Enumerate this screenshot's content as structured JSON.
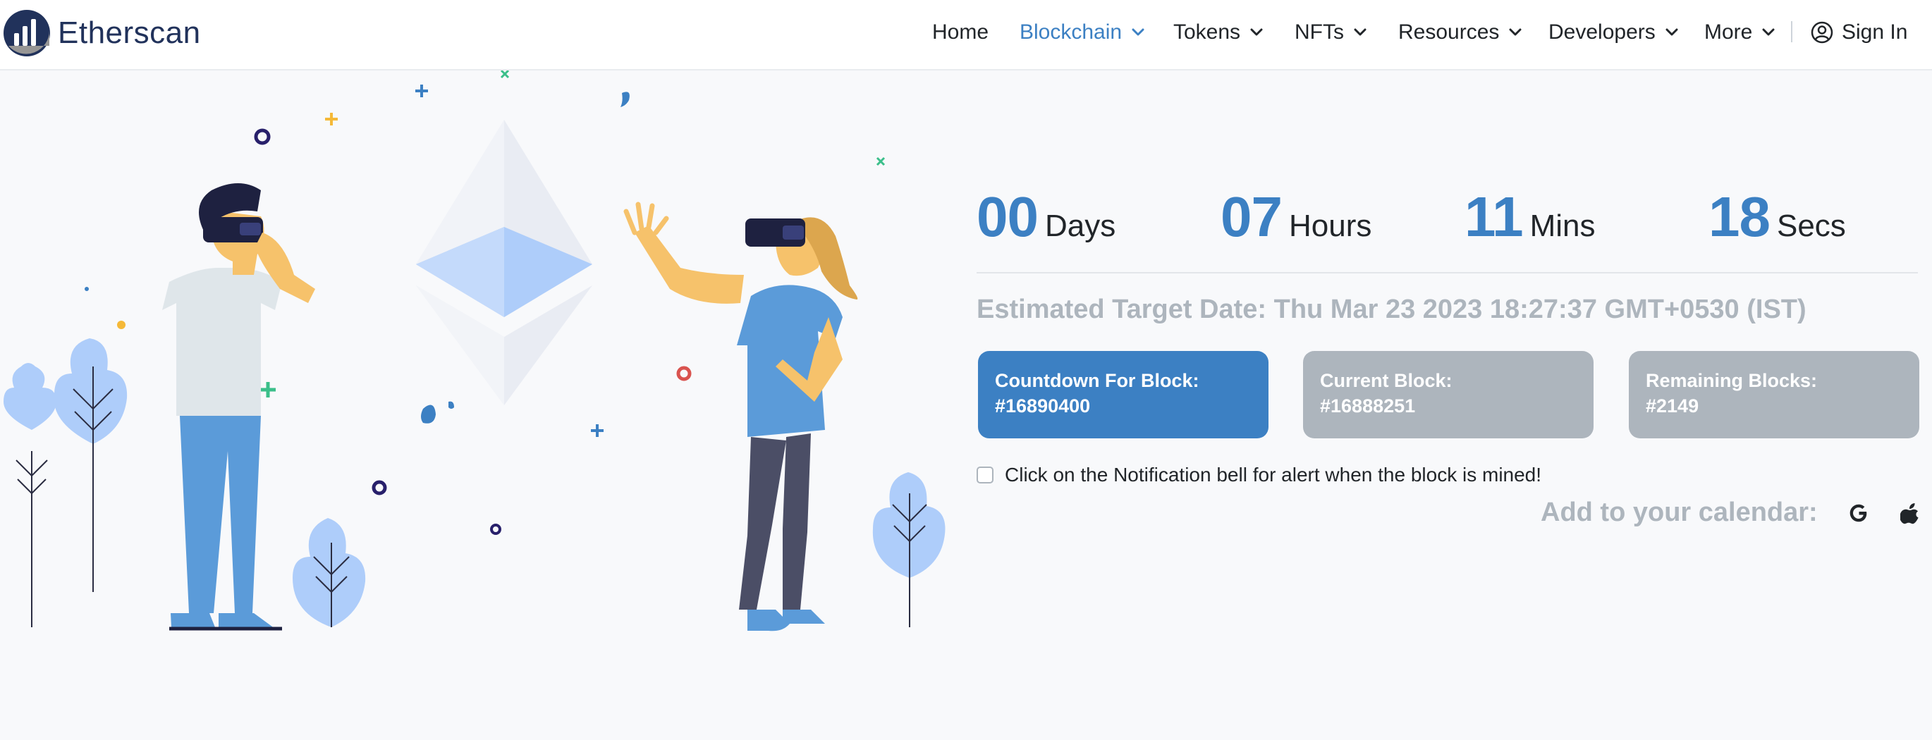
{
  "brand": {
    "name": "Etherscan"
  },
  "nav": {
    "items": [
      {
        "label": "Home",
        "dropdown": false,
        "active": false
      },
      {
        "label": "Blockchain",
        "dropdown": true,
        "active": true
      },
      {
        "label": "Tokens",
        "dropdown": true,
        "active": false
      },
      {
        "label": "NFTs",
        "dropdown": true,
        "active": false
      },
      {
        "label": "Resources",
        "dropdown": true,
        "active": false
      },
      {
        "label": "Developers",
        "dropdown": true,
        "active": false
      },
      {
        "label": "More",
        "dropdown": true,
        "active": false
      }
    ],
    "signin_label": "Sign In",
    "signin_icon": "user-circle-icon"
  },
  "countdown": {
    "days": {
      "value": "00",
      "label": "Days"
    },
    "hours": {
      "value": "07",
      "label": "Hours"
    },
    "mins": {
      "value": "11",
      "label": "Mins"
    },
    "secs": {
      "value": "18",
      "label": "Secs"
    }
  },
  "target_date": "Estimated Target Date: Thu Mar 23 2023 18:27:37 GMT+0530 (IST)",
  "blocks": {
    "countdown": {
      "label": "Countdown For Block:",
      "value": "#16890400"
    },
    "current": {
      "label": "Current Block:",
      "value": "#16888251"
    },
    "remaining": {
      "label": "Remaining Blocks:",
      "value": "#2149"
    }
  },
  "notification": {
    "label": "Click on the Notification bell for alert when the block is mined!",
    "checked": false
  },
  "calendar": {
    "label": "Add to your calendar:",
    "google_icon": "google-icon",
    "apple_icon": "apple-icon"
  },
  "colors": {
    "accent": "#3c80c3",
    "muted": "#adb5bd",
    "brand_navy": "#21325b",
    "background": "#f8f9fb"
  }
}
